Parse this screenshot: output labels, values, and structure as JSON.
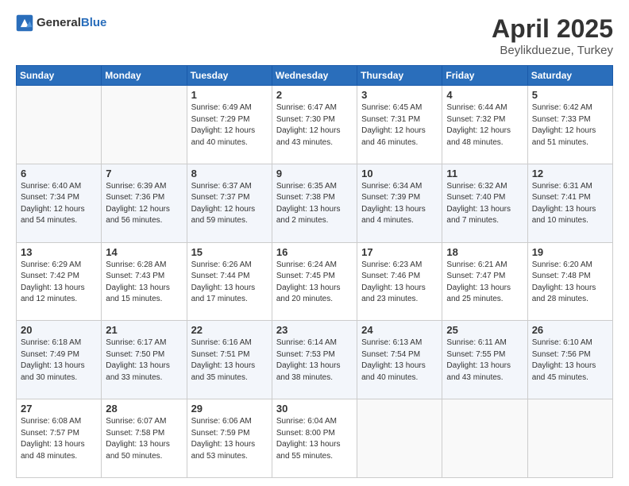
{
  "header": {
    "logo_general": "General",
    "logo_blue": "Blue",
    "title": "April 2025",
    "location": "Beylikduezue, Turkey"
  },
  "weekdays": [
    "Sunday",
    "Monday",
    "Tuesday",
    "Wednesday",
    "Thursday",
    "Friday",
    "Saturday"
  ],
  "weeks": [
    [
      {
        "day": "",
        "info": ""
      },
      {
        "day": "",
        "info": ""
      },
      {
        "day": "1",
        "info": "Sunrise: 6:49 AM\nSunset: 7:29 PM\nDaylight: 12 hours and 40 minutes."
      },
      {
        "day": "2",
        "info": "Sunrise: 6:47 AM\nSunset: 7:30 PM\nDaylight: 12 hours and 43 minutes."
      },
      {
        "day": "3",
        "info": "Sunrise: 6:45 AM\nSunset: 7:31 PM\nDaylight: 12 hours and 46 minutes."
      },
      {
        "day": "4",
        "info": "Sunrise: 6:44 AM\nSunset: 7:32 PM\nDaylight: 12 hours and 48 minutes."
      },
      {
        "day": "5",
        "info": "Sunrise: 6:42 AM\nSunset: 7:33 PM\nDaylight: 12 hours and 51 minutes."
      }
    ],
    [
      {
        "day": "6",
        "info": "Sunrise: 6:40 AM\nSunset: 7:34 PM\nDaylight: 12 hours and 54 minutes."
      },
      {
        "day": "7",
        "info": "Sunrise: 6:39 AM\nSunset: 7:36 PM\nDaylight: 12 hours and 56 minutes."
      },
      {
        "day": "8",
        "info": "Sunrise: 6:37 AM\nSunset: 7:37 PM\nDaylight: 12 hours and 59 minutes."
      },
      {
        "day": "9",
        "info": "Sunrise: 6:35 AM\nSunset: 7:38 PM\nDaylight: 13 hours and 2 minutes."
      },
      {
        "day": "10",
        "info": "Sunrise: 6:34 AM\nSunset: 7:39 PM\nDaylight: 13 hours and 4 minutes."
      },
      {
        "day": "11",
        "info": "Sunrise: 6:32 AM\nSunset: 7:40 PM\nDaylight: 13 hours and 7 minutes."
      },
      {
        "day": "12",
        "info": "Sunrise: 6:31 AM\nSunset: 7:41 PM\nDaylight: 13 hours and 10 minutes."
      }
    ],
    [
      {
        "day": "13",
        "info": "Sunrise: 6:29 AM\nSunset: 7:42 PM\nDaylight: 13 hours and 12 minutes."
      },
      {
        "day": "14",
        "info": "Sunrise: 6:28 AM\nSunset: 7:43 PM\nDaylight: 13 hours and 15 minutes."
      },
      {
        "day": "15",
        "info": "Sunrise: 6:26 AM\nSunset: 7:44 PM\nDaylight: 13 hours and 17 minutes."
      },
      {
        "day": "16",
        "info": "Sunrise: 6:24 AM\nSunset: 7:45 PM\nDaylight: 13 hours and 20 minutes."
      },
      {
        "day": "17",
        "info": "Sunrise: 6:23 AM\nSunset: 7:46 PM\nDaylight: 13 hours and 23 minutes."
      },
      {
        "day": "18",
        "info": "Sunrise: 6:21 AM\nSunset: 7:47 PM\nDaylight: 13 hours and 25 minutes."
      },
      {
        "day": "19",
        "info": "Sunrise: 6:20 AM\nSunset: 7:48 PM\nDaylight: 13 hours and 28 minutes."
      }
    ],
    [
      {
        "day": "20",
        "info": "Sunrise: 6:18 AM\nSunset: 7:49 PM\nDaylight: 13 hours and 30 minutes."
      },
      {
        "day": "21",
        "info": "Sunrise: 6:17 AM\nSunset: 7:50 PM\nDaylight: 13 hours and 33 minutes."
      },
      {
        "day": "22",
        "info": "Sunrise: 6:16 AM\nSunset: 7:51 PM\nDaylight: 13 hours and 35 minutes."
      },
      {
        "day": "23",
        "info": "Sunrise: 6:14 AM\nSunset: 7:53 PM\nDaylight: 13 hours and 38 minutes."
      },
      {
        "day": "24",
        "info": "Sunrise: 6:13 AM\nSunset: 7:54 PM\nDaylight: 13 hours and 40 minutes."
      },
      {
        "day": "25",
        "info": "Sunrise: 6:11 AM\nSunset: 7:55 PM\nDaylight: 13 hours and 43 minutes."
      },
      {
        "day": "26",
        "info": "Sunrise: 6:10 AM\nSunset: 7:56 PM\nDaylight: 13 hours and 45 minutes."
      }
    ],
    [
      {
        "day": "27",
        "info": "Sunrise: 6:08 AM\nSunset: 7:57 PM\nDaylight: 13 hours and 48 minutes."
      },
      {
        "day": "28",
        "info": "Sunrise: 6:07 AM\nSunset: 7:58 PM\nDaylight: 13 hours and 50 minutes."
      },
      {
        "day": "29",
        "info": "Sunrise: 6:06 AM\nSunset: 7:59 PM\nDaylight: 13 hours and 53 minutes."
      },
      {
        "day": "30",
        "info": "Sunrise: 6:04 AM\nSunset: 8:00 PM\nDaylight: 13 hours and 55 minutes."
      },
      {
        "day": "",
        "info": ""
      },
      {
        "day": "",
        "info": ""
      },
      {
        "day": "",
        "info": ""
      }
    ]
  ]
}
